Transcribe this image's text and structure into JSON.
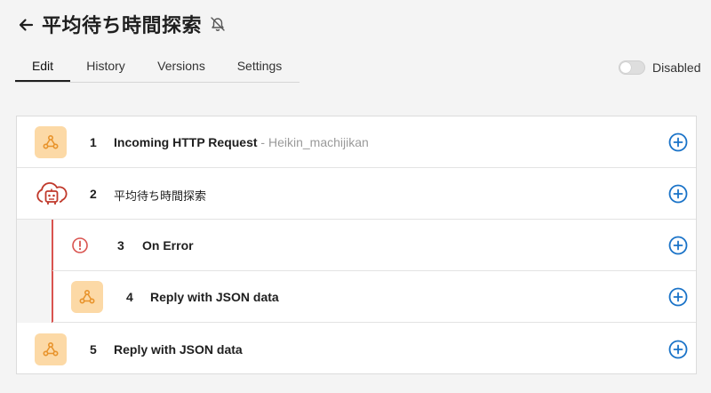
{
  "header": {
    "title": "平均待ち時間探索"
  },
  "tabs": [
    {
      "label": "Edit",
      "active": true
    },
    {
      "label": "History",
      "active": false
    },
    {
      "label": "Versions",
      "active": false
    },
    {
      "label": "Settings",
      "active": false
    }
  ],
  "status_toggle": {
    "label": "Disabled",
    "on": false
  },
  "colors": {
    "accent": "#1a73c8",
    "webhook_badge": "#fcd9a6",
    "webhook_icon": "#e8932b",
    "error": "#d9534f"
  },
  "steps": [
    {
      "number": "1",
      "label": "Incoming HTTP Request",
      "sub": " - Heikin_machijikan",
      "icon": "webhook-icon"
    },
    {
      "number": "2",
      "label": "平均待ち時間探索",
      "sub": "",
      "icon": "cloud-robot-icon"
    },
    {
      "number": "3",
      "label": "On Error",
      "sub": "",
      "icon": "error-circle-icon"
    },
    {
      "number": "4",
      "label": "Reply with JSON data",
      "sub": "",
      "icon": "webhook-icon"
    },
    {
      "number": "5",
      "label": "Reply with JSON data",
      "sub": "",
      "icon": "webhook-icon"
    }
  ]
}
